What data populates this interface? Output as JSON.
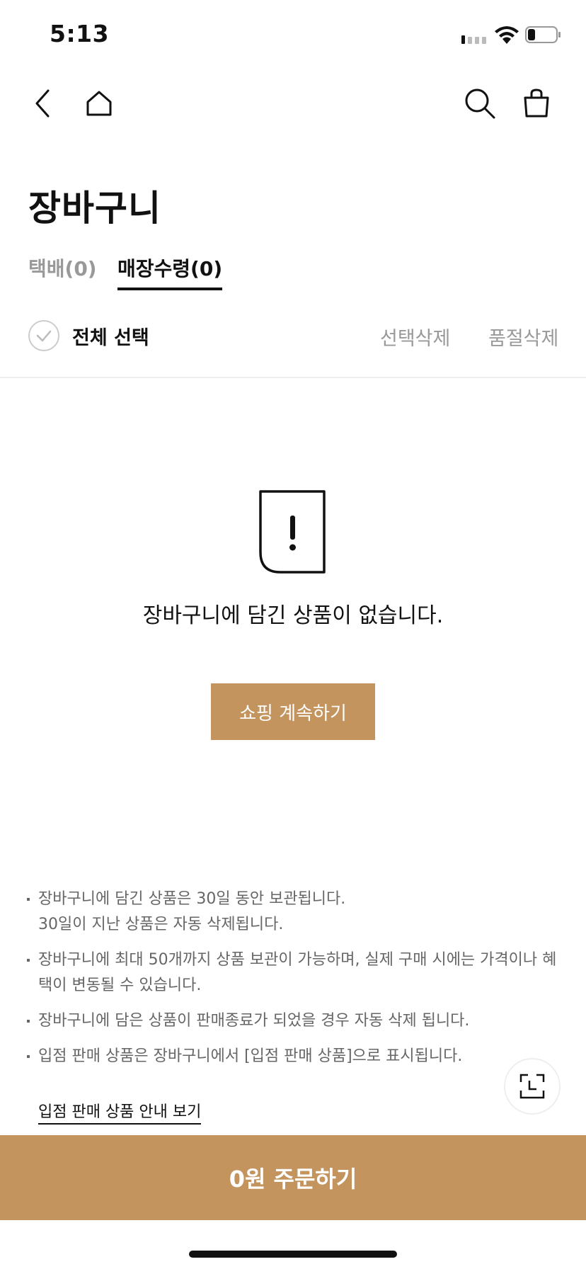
{
  "status_bar": {
    "time": "5:13"
  },
  "nav": {
    "icons": [
      "back-icon",
      "home-icon",
      "search-icon",
      "cart-icon"
    ]
  },
  "page": {
    "title": "장바구니"
  },
  "tabs": [
    {
      "label": "택배(0)",
      "active": false
    },
    {
      "label": "매장수령(0)",
      "active": true
    }
  ],
  "select_bar": {
    "select_all_label": "전체 선택",
    "delete_selected": "선택삭제",
    "delete_soldout": "품절삭제"
  },
  "empty_state": {
    "message": "장바구니에 담긴 상품이 없습니다.",
    "button_label": "쇼핑 계속하기"
  },
  "notices": [
    {
      "lines": [
        "장바구니에 담긴 상품은 30일 동안 보관됩니다.",
        "30일이 지난 상품은 자동 삭제됩니다."
      ]
    },
    {
      "lines": [
        "장바구니에 최대 50개까지 상품 보관이 가능하며, 실제 구매 시에는 가격이나 혜",
        "택이 변동될 수 있습니다."
      ]
    },
    {
      "lines": [
        "장바구니에 담은 상품이 판매종료가 되었을 경우 자동 삭제 됩니다."
      ]
    },
    {
      "lines": [
        "입점 판매 상품은 장바구니에서 [입점 판매 상품]으로 표시됩니다."
      ]
    }
  ],
  "guide_link": "입점 판매 상품 안내 보기",
  "order_button": "0원 주문하기",
  "colors": {
    "accent": "#c4945f",
    "text": "#111111",
    "muted": "#999999",
    "notice": "#666666"
  }
}
